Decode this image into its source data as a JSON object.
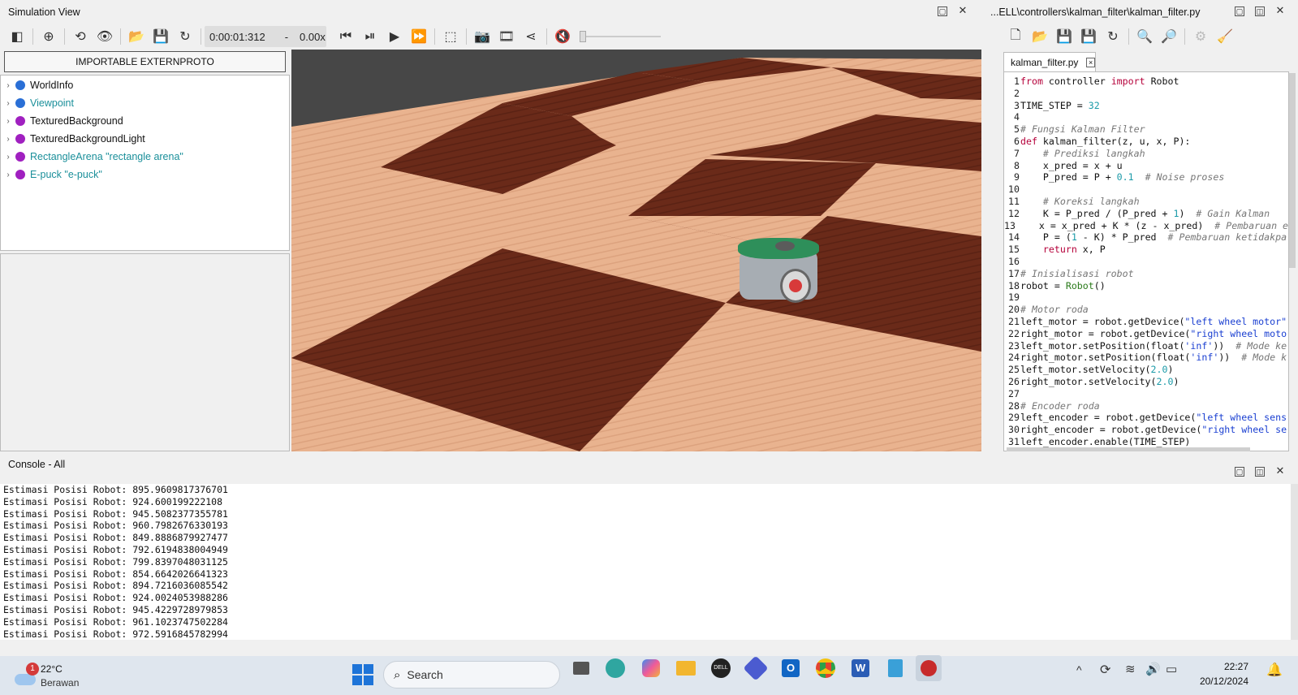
{
  "sim": {
    "title": "Simulation View",
    "time": "0:00:01:312",
    "time_sep": "-",
    "speed": "0.00x",
    "importable_btn": "IMPORTABLE EXTERNPROTO"
  },
  "scene_tree": [
    {
      "label": "WorldInfo",
      "color": "#2a6fd6",
      "text_color": "#111"
    },
    {
      "label": "Viewpoint",
      "color": "#2a6fd6",
      "text_color": "#1a8f9a"
    },
    {
      "label": "TexturedBackground",
      "color": "#a020c0",
      "text_color": "#111"
    },
    {
      "label": "TexturedBackgroundLight",
      "color": "#a020c0",
      "text_color": "#111"
    },
    {
      "label": "RectangleArena \"rectangle arena\"",
      "color": "#a020c0",
      "text_color": "#1a8f9a"
    },
    {
      "label": "E-puck \"e-puck\"",
      "color": "#a020c0",
      "text_color": "#1a8f9a"
    }
  ],
  "editor": {
    "title": "...ELL\\controllers\\kalman_filter\\kalman_filter.py",
    "tab_label": "kalman_filter.py",
    "tab_close": "×",
    "lines": [
      [
        [
          "from ",
          "kw"
        ],
        [
          "controller ",
          "t"
        ],
        [
          "import ",
          "kw"
        ],
        [
          "Robot",
          "t"
        ]
      ],
      [],
      [
        [
          "TIME_STEP = ",
          "t"
        ],
        [
          "32",
          "num"
        ]
      ],
      [],
      [
        [
          "# Fungsi Kalman Filter",
          "cm"
        ]
      ],
      [
        [
          "def ",
          "kw"
        ],
        [
          "kalman_filter(z, u, x, P):",
          "t"
        ]
      ],
      [
        [
          "    # Prediksi langkah",
          "cm"
        ]
      ],
      [
        [
          "    x_pred = x + u",
          "t"
        ]
      ],
      [
        [
          "    P_pred = P + ",
          "t"
        ],
        [
          "0.1",
          "num"
        ],
        [
          "  # Noise proses",
          "cm"
        ]
      ],
      [],
      [
        [
          "    # Koreksi langkah",
          "cm"
        ]
      ],
      [
        [
          "    K = P_pred / (P_pred + ",
          "t"
        ],
        [
          "1",
          "num"
        ],
        [
          ")  ",
          "t"
        ],
        [
          "# Gain Kalman",
          "cm"
        ]
      ],
      [
        [
          "    x = x_pred + K * (z - x_pred)  ",
          "t"
        ],
        [
          "# Pembaruan e",
          "cm"
        ]
      ],
      [
        [
          "    P = (",
          "t"
        ],
        [
          "1",
          "num"
        ],
        [
          " - K) * P_pred  ",
          "t"
        ],
        [
          "# Pembaruan ketidakpa",
          "cm"
        ]
      ],
      [
        [
          "    return ",
          "kw"
        ],
        [
          "x, P",
          "t"
        ]
      ],
      [],
      [
        [
          "# Inisialisasi robot",
          "cm"
        ]
      ],
      [
        [
          "robot = ",
          "t"
        ],
        [
          "Robot",
          "cls"
        ],
        [
          "()",
          "t"
        ]
      ],
      [],
      [
        [
          "# Motor roda",
          "cm"
        ]
      ],
      [
        [
          "left_motor = robot.getDevice(",
          "t"
        ],
        [
          "\"left wheel motor\"",
          "str"
        ]
      ],
      [
        [
          "right_motor = robot.getDevice(",
          "t"
        ],
        [
          "\"right wheel moto",
          "str"
        ]
      ],
      [
        [
          "left_motor.setPosition(float(",
          "t"
        ],
        [
          "'inf'",
          "str"
        ],
        [
          "))  ",
          "t"
        ],
        [
          "# Mode ke",
          "cm"
        ]
      ],
      [
        [
          "right_motor.setPosition(float(",
          "t"
        ],
        [
          "'inf'",
          "str"
        ],
        [
          "))  ",
          "t"
        ],
        [
          "# Mode k",
          "cm"
        ]
      ],
      [
        [
          "left_motor.setVelocity(",
          "t"
        ],
        [
          "2.0",
          "num"
        ],
        [
          ")",
          "t"
        ]
      ],
      [
        [
          "right_motor.setVelocity(",
          "t"
        ],
        [
          "2.0",
          "num"
        ],
        [
          ")",
          "t"
        ]
      ],
      [],
      [
        [
          "# Encoder roda",
          "cm"
        ]
      ],
      [
        [
          "left_encoder = robot.getDevice(",
          "t"
        ],
        [
          "\"left wheel sens",
          "str"
        ]
      ],
      [
        [
          "right_encoder = robot.getDevice(",
          "t"
        ],
        [
          "\"right wheel se",
          "str"
        ]
      ],
      [
        [
          "left_encoder.enable(TIME_STEP)",
          "t"
        ]
      ]
    ]
  },
  "console": {
    "title": "Console - All",
    "lines": [
      "Estimasi Posisi Robot: 895.9609817376701",
      "Estimasi Posisi Robot: 924.600199222108",
      "Estimasi Posisi Robot: 945.5082377355781",
      "Estimasi Posisi Robot: 960.7982676330193",
      "Estimasi Posisi Robot: 849.8886879927477",
      "Estimasi Posisi Robot: 792.6194838004949",
      "Estimasi Posisi Robot: 799.8397048031125",
      "Estimasi Posisi Robot: 854.6642026641323",
      "Estimasi Posisi Robot: 894.7216036085542",
      "Estimasi Posisi Robot: 924.0024053988286",
      "Estimasi Posisi Robot: 945.4229728979853",
      "Estimasi Posisi Robot: 961.1023747502284",
      "Estimasi Posisi Robot: 972.5916845782994"
    ]
  },
  "taskbar": {
    "weather_temp": "22°C",
    "weather_desc": "Berawan",
    "weather_badge": "1",
    "search_label": "Search",
    "time": "22:27",
    "date": "20/12/2024"
  },
  "colors": {
    "kw": "#b5003a",
    "num": "#1a9aa8",
    "cm": "#777777",
    "str": "#1a3fd1",
    "cls": "#2a7a1a",
    "t": "#111111"
  }
}
